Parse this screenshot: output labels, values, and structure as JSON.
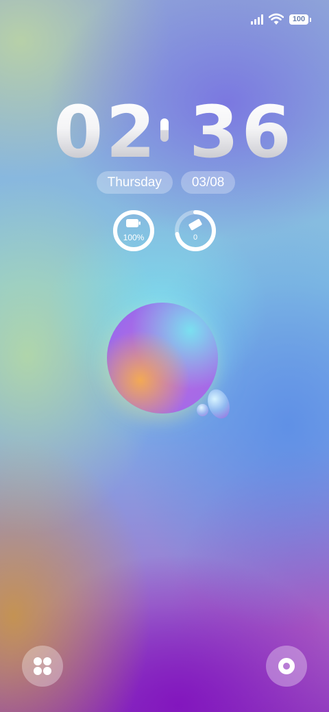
{
  "status_bar": {
    "signal_icon": "cellular-signal-icon",
    "wifi_icon": "wifi-icon",
    "battery_icon": "battery-icon",
    "battery_level": "100"
  },
  "clock": {
    "hours": "02",
    "minutes": "36"
  },
  "date": {
    "weekday": "Thursday",
    "date": "03/08"
  },
  "widgets": {
    "battery": {
      "icon": "battery-charging-icon",
      "label": "100%",
      "level": 1.0
    },
    "eraser": {
      "icon": "eraser-icon",
      "label": "0",
      "level": 0.0
    }
  },
  "shortcuts": {
    "left_icon": "apps-grid-icon",
    "right_icon": "camera-icon"
  },
  "colors": {
    "ring_color": "#ffffff",
    "pill_background": "rgba(255,255,255,0.28)"
  }
}
